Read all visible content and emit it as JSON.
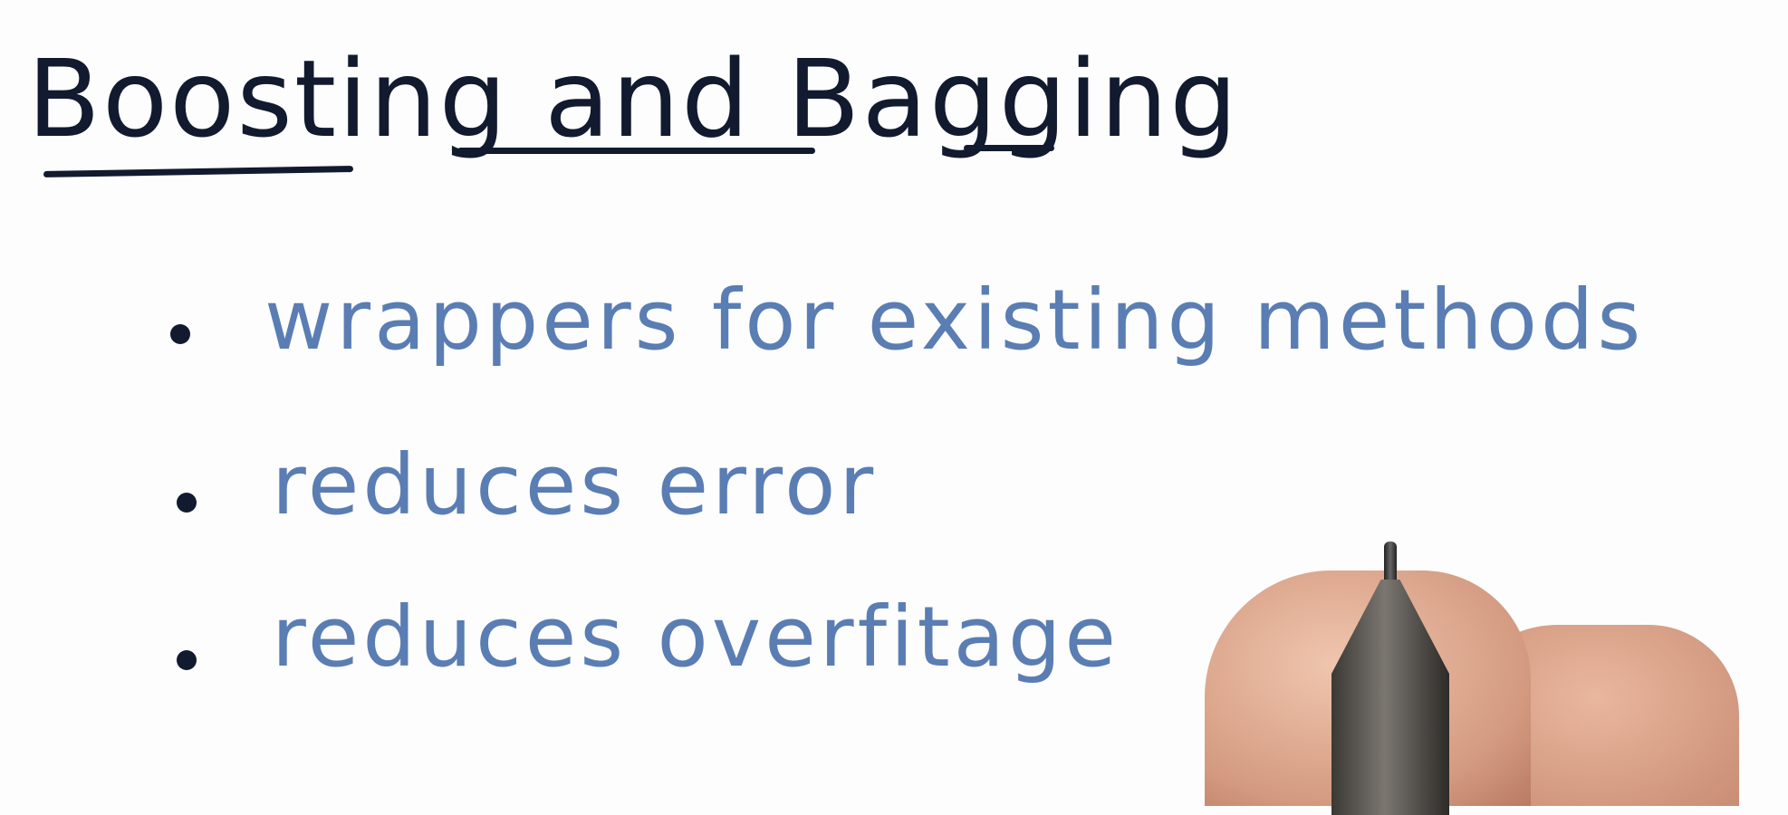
{
  "title": {
    "word1": "Boosting",
    "word2": "and",
    "word3": "Bagging"
  },
  "bullets": [
    {
      "text": "wrappers for existing methods"
    },
    {
      "text": "reduces error"
    },
    {
      "text": "reduces overfitage"
    }
  ],
  "colors": {
    "ink": "#111a2e",
    "blue_ink": "#5a7db3"
  }
}
